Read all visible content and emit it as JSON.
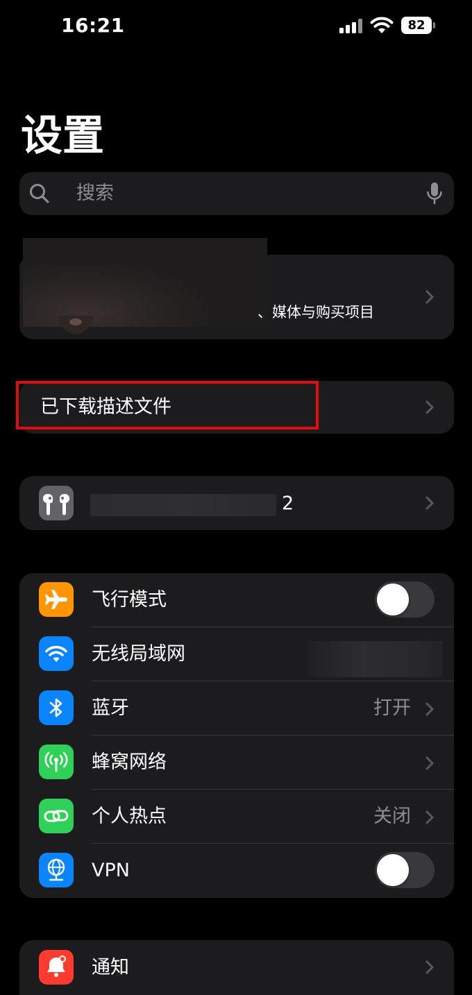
{
  "status_bar": {
    "time": "16:21",
    "battery": "82"
  },
  "page": {
    "title": "设置"
  },
  "search": {
    "placeholder": "搜索"
  },
  "profile": {
    "subtitle": "、媒体与购买项目"
  },
  "downloaded_profile": {
    "label": "已下载描述文件"
  },
  "airpods": {
    "label_suffix": "2"
  },
  "connectivity": {
    "airplane": {
      "label": "飞行模式"
    },
    "wifi": {
      "label": "无线局域网"
    },
    "bluetooth": {
      "label": "蓝牙",
      "value": "打开"
    },
    "cellular": {
      "label": "蜂窝网络"
    },
    "hotspot": {
      "label": "个人热点",
      "value": "关闭"
    },
    "vpn": {
      "label": "VPN"
    }
  },
  "notifications": {
    "label": "通知"
  },
  "colors": {
    "airplane": "#ff9500",
    "wifi": "#0a84ff",
    "bluetooth": "#0a84ff",
    "cellular": "#30d158",
    "hotspot": "#30d158",
    "vpn": "#0a84ff",
    "notifications": "#ff3b30",
    "highlight": "#e30b0b"
  }
}
